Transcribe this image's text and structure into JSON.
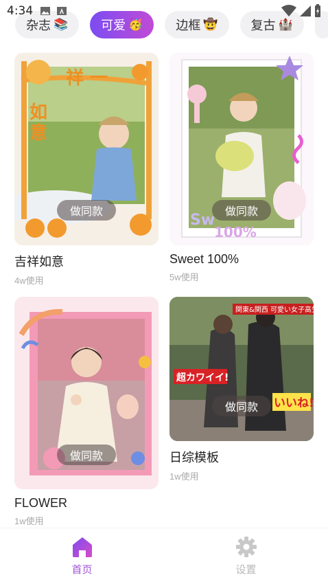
{
  "status_bar": {
    "time": "4:34"
  },
  "tabs": [
    {
      "label": "杂志",
      "emoji": "📚",
      "active": false
    },
    {
      "label": "可爱",
      "emoji": "🥳",
      "active": true
    },
    {
      "label": "边框",
      "emoji": "🤠",
      "active": false
    },
    {
      "label": "复古",
      "emoji": "🏰",
      "active": false
    }
  ],
  "cards": [
    {
      "title": "吉祥如意",
      "usage": "4w使用",
      "button": "做同款",
      "frame_text": "吉祥如意"
    },
    {
      "title": "Sweet 100%",
      "usage": "5w使用",
      "button": "做同款",
      "frame_text": "Sweet 100%"
    },
    {
      "title": "FLOWER",
      "usage": "1w使用",
      "button": "做同款"
    },
    {
      "title": "日综模板",
      "usage": "1w使用",
      "button": "做同款",
      "frame_text_1": "関東&関西 可愛い女子高生",
      "frame_text_2": "超カワイイ!",
      "frame_text_3": "いいね!"
    }
  ],
  "bottom_nav": {
    "home_label": "首页",
    "settings_label": "设置"
  },
  "colors": {
    "accent_start": "#7b4cf1",
    "accent_end": "#c04bd6",
    "active_nav": "#a256d8",
    "inactive_nav": "#b9b9b9"
  }
}
